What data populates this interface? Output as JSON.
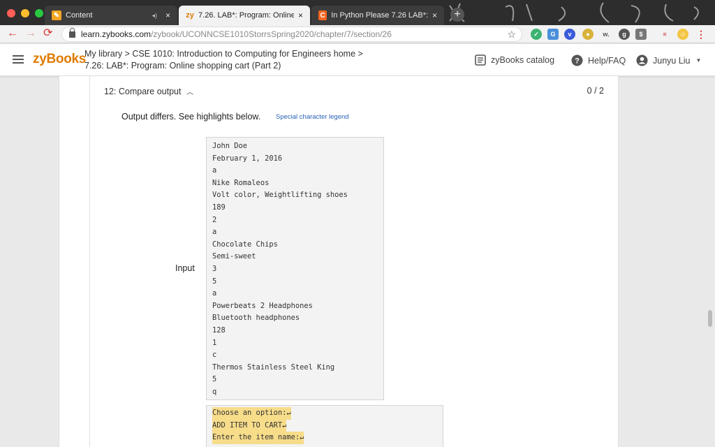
{
  "browser": {
    "tabs": [
      {
        "title": "Content",
        "close": "×",
        "mute": "◂)"
      },
      {
        "favicon_text": "zy",
        "title": "7.26. LAB*: Program: Online sho",
        "close": "×"
      },
      {
        "favicon_text": "C",
        "title": "In Python Please 7.26 LAB*: Pro",
        "close": "×"
      }
    ],
    "new_tab": "+",
    "url_host": "learn.zybooks.com",
    "url_path": "/zybook/UCONNCSE1010StorrsSpring2020/chapter/7/section/26",
    "bookmark_icon": "☆"
  },
  "header": {
    "logo": "zyBooks",
    "breadcrumb_line1": "My library > CSE 1010: Introduction to Computing for Engineers home >",
    "breadcrumb_line2": "7.26: LAB*: Program: Online shopping cart (Part 2)",
    "catalog": "zyBooks catalog",
    "help": "Help/FAQ",
    "user": "Junyu Liu"
  },
  "test": {
    "title": "12: Compare output",
    "score": "0 / 2",
    "message": "Output differs. See highlights below.",
    "legend_link": "Special character legend",
    "input_label": "Input",
    "input_lines": [
      "John Doe",
      "February 1, 2016",
      "a",
      "Nike Romaleos",
      "Volt color, Weightlifting shoes",
      "189",
      "2",
      "a",
      "Chocolate Chips",
      "Semi-sweet",
      "3",
      "5",
      "a",
      "Powerbeats 2 Headphones",
      "Bluetooth headphones",
      "128",
      "1",
      "c",
      "Thermos Stainless Steel King",
      "5",
      "q"
    ],
    "output_lines": [
      "Choose an option:↵",
      "ADD ITEM TO CART↵",
      "Enter the item name:↵"
    ]
  }
}
